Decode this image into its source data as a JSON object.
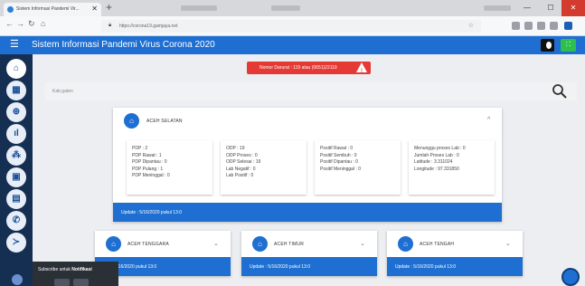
{
  "browser": {
    "tab_title": "Sistem Informasi Pandemi Vir...",
    "tab_close": "✕",
    "new_tab": "+",
    "url": "https://corona19.gamjaya.net",
    "window_minimize": "—",
    "window_maximize": "☐",
    "window_close": "✕"
  },
  "header": {
    "menu_icon": "☰",
    "title": "Sistem Informasi Pandemi Virus Corona 2020",
    "theme_toggle_icon": "moon-icon",
    "fullscreen_icon": "⛶"
  },
  "sidebar": {
    "items": [
      {
        "icon": "home-icon",
        "glyph": "⌂"
      },
      {
        "icon": "map-icon",
        "glyph": "▦"
      },
      {
        "icon": "globe-icon",
        "glyph": "⊕"
      },
      {
        "icon": "chart-icon",
        "glyph": "ıl"
      },
      {
        "icon": "group-icon",
        "glyph": "⁂"
      },
      {
        "icon": "inbox-icon",
        "glyph": "▣"
      },
      {
        "icon": "document-icon",
        "glyph": "▤"
      },
      {
        "icon": "phone-icon",
        "glyph": "✆"
      },
      {
        "icon": "terminal-icon",
        "glyph": "≻"
      }
    ]
  },
  "notice": {
    "text": "Nomor Darurat : 119 atau (0651)22119"
  },
  "search": {
    "placeholder": "Kab.gaten"
  },
  "main_card": {
    "title": "ACEH SELATAN",
    "collapse_glyph": "^",
    "columns": [
      [
        "PDP : 2",
        "PDP Rawat : 1",
        "PDP Dipantau : 0",
        "PDP Pulang : 1",
        "PDP Meninggal : 0"
      ],
      [
        "ODP : 19",
        "ODP Proses : 0",
        "ODP Selesai : 19",
        "Lab Negatif : 0",
        "Lab Positif : 0"
      ],
      [
        "Positif Rawat : 0",
        "Positif Sembuh : 0",
        "Positif Dipantau : 0",
        "Positif Meninggal : 0"
      ],
      [
        "Menunggu proses Lab : 0",
        "Jumlah Proses Lab : 0",
        "Latitude : 3.311024",
        "Longitude : 97.331850"
      ]
    ],
    "update": "Update : 5/16/2020 pukul 13:0"
  },
  "small_cards": [
    {
      "title": "ACEH TENGGARA",
      "update": "...te : 5/16/2020 pukul 13:0"
    },
    {
      "title": "ACEH TIMUR",
      "update": "Update : 5/16/2020 pukul 13:0"
    },
    {
      "title": "ACEH TENGAH",
      "update": "Update : 5/16/2020 pukul 13:0"
    }
  ],
  "notification": {
    "text_prefix": "Subscribe untuk ",
    "text_bold": "Notifikasi"
  },
  "colors": {
    "primary": "#1e6fd1",
    "sidebar": "#152f52",
    "danger": "#e53935"
  }
}
